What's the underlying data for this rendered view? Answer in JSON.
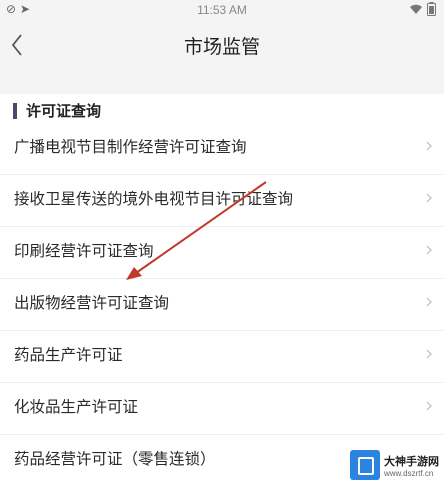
{
  "status_bar": {
    "time": "11:53 AM",
    "left_icons": [
      "settings-icon",
      "location-arrow-icon"
    ],
    "right_icons": [
      "wifi-icon",
      "battery-icon"
    ]
  },
  "nav": {
    "title": "市场监管",
    "back_icon": "chevron-left-icon"
  },
  "section": {
    "title": "许可证查询",
    "items": [
      {
        "label": "广播电视节目制作经营许可证查询"
      },
      {
        "label": "接收卫星传送的境外电视节目许可证查询"
      },
      {
        "label": "印刷经营许可证查询"
      },
      {
        "label": "出版物经营许可证查询"
      },
      {
        "label": "药品生产许可证"
      },
      {
        "label": "化妆品生产许可证"
      },
      {
        "label": "药品经营许可证（零售连锁）"
      }
    ]
  },
  "annotation": {
    "type": "red-arrow",
    "color": "#c0392b"
  },
  "watermark": {
    "name": "大神手游网",
    "url": "www.dszrtf.cn"
  }
}
